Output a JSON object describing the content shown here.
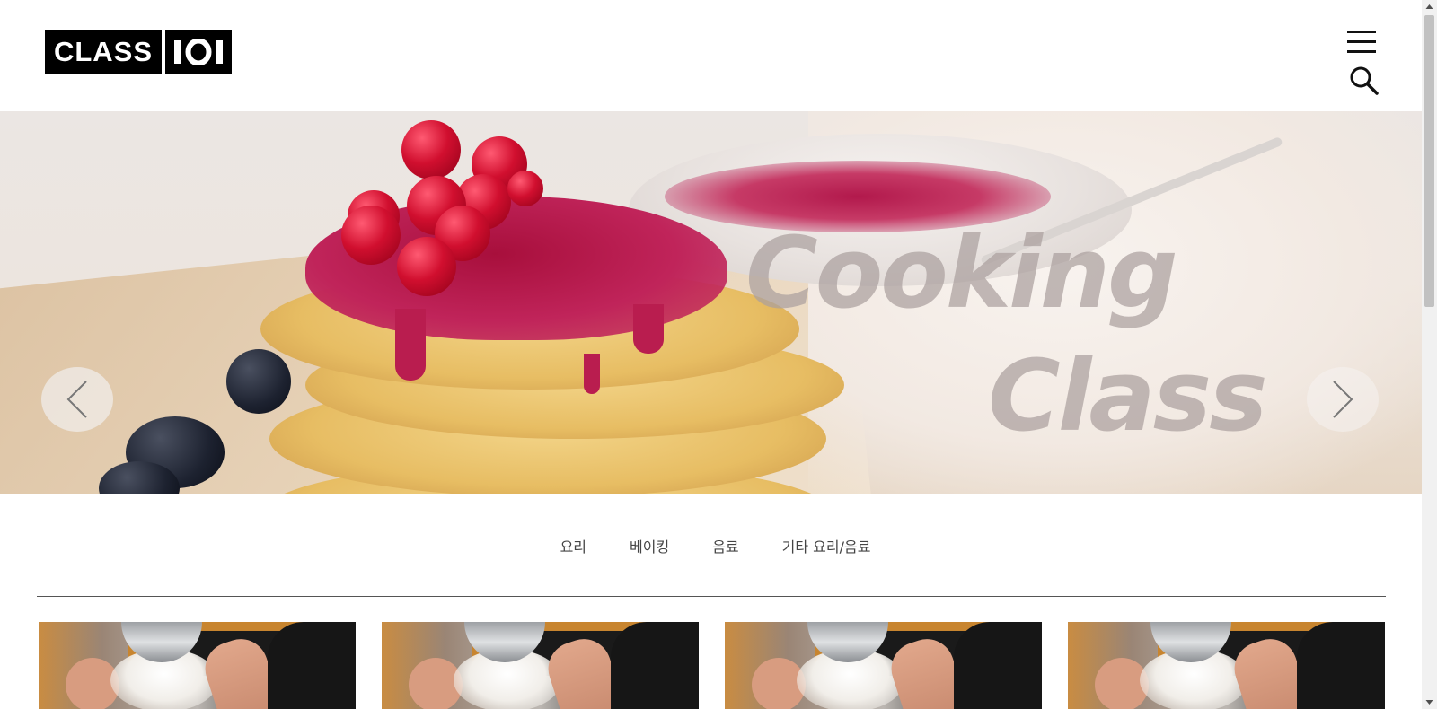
{
  "header": {
    "logo": {
      "part1": "CLASS",
      "part2": "101"
    },
    "menu_icon": "hamburger-menu-icon",
    "search_icon": "search-icon"
  },
  "hero": {
    "title_line1": "Cooking",
    "title_line2": "Class",
    "prev_icon": "chevron-left-icon",
    "next_icon": "chevron-right-icon"
  },
  "categories": {
    "items": [
      {
        "label": "요리"
      },
      {
        "label": "베이킹"
      },
      {
        "label": "음료"
      },
      {
        "label": "기타 요리/음료"
      }
    ]
  },
  "thumbnails": {
    "count_visible": 4
  },
  "colors": {
    "logo_bg": "#000000",
    "logo_text": "#ffffff",
    "hero_text": "#aaa09e",
    "divider": "#555555"
  }
}
